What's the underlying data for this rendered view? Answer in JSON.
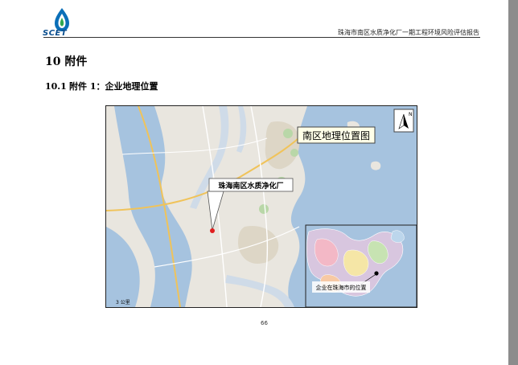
{
  "header": {
    "logo_text": "SCET",
    "title": "珠海市南区水质净化厂一期工程环境风险评估报告"
  },
  "chapter": {
    "title": "10 附件"
  },
  "section": {
    "number": "10.1",
    "title": "附件 1：企业地理位置"
  },
  "map": {
    "title_box": "南区地理位置图",
    "site_label": "珠海南区水质净化厂",
    "inset_label": "企业在珠海市的位置",
    "north_letter": "N",
    "scale_text": "3 公里",
    "colors": {
      "sea": "#a6c3df",
      "land": "#e9e6df",
      "river": "#cfdbe8",
      "site_marker": "#e01e1e",
      "road": "#f0c35a"
    }
  },
  "footer": {
    "page_number": "66"
  }
}
